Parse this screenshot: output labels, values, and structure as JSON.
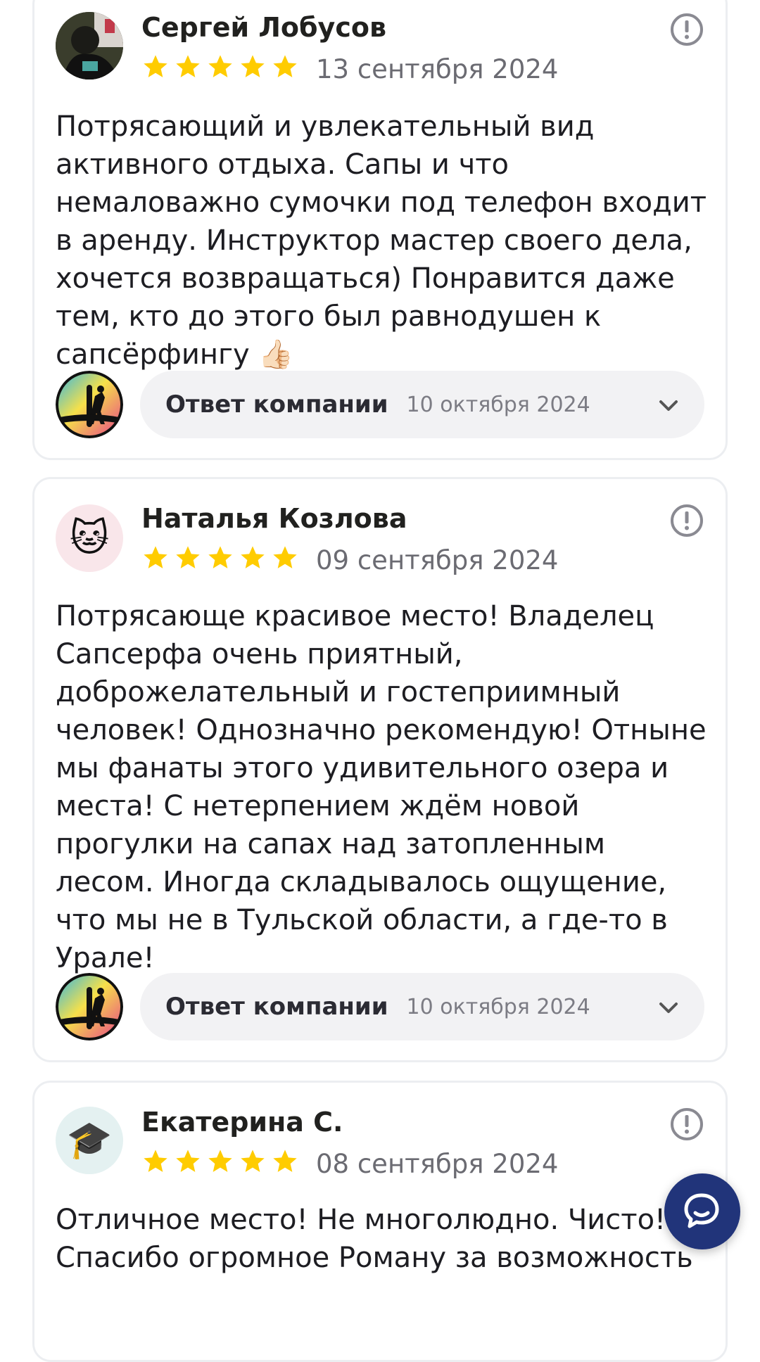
{
  "reviews": [
    {
      "author": "Сергей Лобусов",
      "date": "13 сентября 2024",
      "rating": 5,
      "text": "Потрясающий и увлекательный вид активного отдыха. Сапы и что немаловажно сумочки под телефон входит в аренду. Инструктор мастер своего дела, хочется возвращаться) Понравится даже тем, кто до этого был равнодушен к сапсёрфингу 👍🏻",
      "reply_label": "Ответ компании",
      "reply_date": "10 октября 2024"
    },
    {
      "author": "Наталья Козлова",
      "date": "09 сентября 2024",
      "rating": 5,
      "text": "Потрясающе красивое место! Владелец Сапсерфа очень приятный, доброжелательный и гостеприимный человек! Однозначно рекомендую! Отныне мы фанаты этого удивительного озера и места! С нетерпением ждём новой прогулки на сапах над затопленным лесом. Иногда складывалось ощущение, что мы не в Тульской области, а где-то в Урале!",
      "reply_label": "Ответ компании",
      "reply_date": "10 октября 2024"
    },
    {
      "author": "Екатерина С.",
      "date": "08 сентября 2024",
      "rating": 5,
      "text": "Отличное место! Не многолюдно. Чисто! Спасибо огромное Роману за возможность"
    }
  ],
  "colors": {
    "star": "#ffcc00",
    "chat_button": "#21347a",
    "card_border": "#eceef1"
  },
  "icons": {
    "complaint": "exclamation-circle-icon",
    "expand": "chevron-down-icon",
    "chat": "chat-bubbles-icon",
    "avatar_2": "cat-emoji",
    "avatar_3": "graduation-cap-emoji"
  }
}
